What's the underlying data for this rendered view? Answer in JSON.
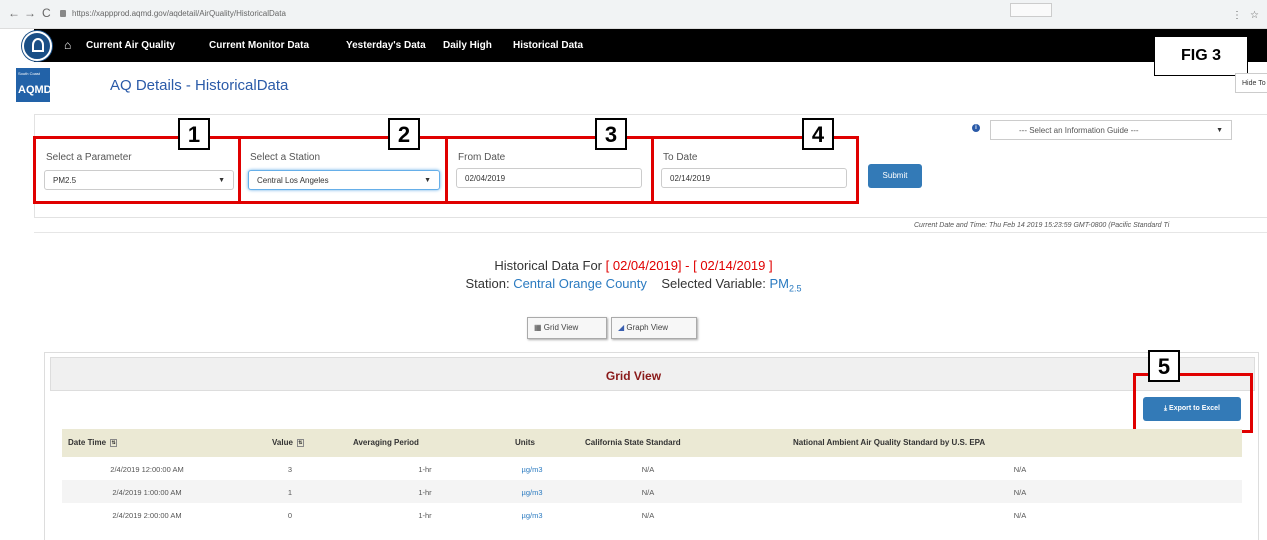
{
  "browser": {
    "back": "←",
    "forward": "→",
    "reload": "C",
    "url": "https://xappprod.aqmd.gov/aqdetail/AirQuality/HistoricalData"
  },
  "nav": {
    "items": [
      "Current Air Quality",
      "Current Monitor Data",
      "Yesterday's Data",
      "Daily High",
      "Historical Data"
    ]
  },
  "logo": {
    "small": "South Coast",
    "text": "AQMD"
  },
  "page_title": "AQ Details - HistoricalData",
  "hide_button": "Hide To",
  "fig_label": "FIG 3",
  "filters": {
    "parameter": {
      "label": "Select a Parameter",
      "value": "PM2.5",
      "callout": "1"
    },
    "station": {
      "label": "Select a Station",
      "value": "Central Los Angeles",
      "callout": "2"
    },
    "from_date": {
      "label": "From Date",
      "value": "02/04/2019",
      "callout": "3"
    },
    "to_date": {
      "label": "To Date",
      "value": "02/14/2019",
      "callout": "4"
    },
    "submit": "Submit",
    "info_guide": "--- Select an Information Guide ---"
  },
  "current_datetime": "Current Date and Time: Thu Feb 14 2019 15:23:59 GMT-0800 (Pacific Standard Ti",
  "heading": {
    "prefix": "Historical Data For",
    "range": "[ 02/04/2019] - [ 02/14/2019 ]",
    "station_label": "Station:",
    "station_value": "Central Orange County",
    "variable_label": "Selected Variable:",
    "variable_value": "PM",
    "variable_sub": "2.5"
  },
  "view_buttons": {
    "grid": "Grid View",
    "graph": "Graph View"
  },
  "grid": {
    "title": "Grid View",
    "export": "Export to Excel",
    "export_callout": "5",
    "columns": [
      "Date Time",
      "Value",
      "Averaging Period",
      "Units",
      "California State Standard",
      "National Ambient Air Quality Standard by U.S. EPA"
    ],
    "rows": [
      [
        "2/4/2019 12:00:00 AM",
        "3",
        "1-hr",
        "µg/m3",
        "N/A",
        "N/A"
      ],
      [
        "2/4/2019 1:00:00 AM",
        "1",
        "1-hr",
        "µg/m3",
        "N/A",
        "N/A"
      ],
      [
        "2/4/2019 2:00:00 AM",
        "0",
        "1-hr",
        "µg/m3",
        "N/A",
        "N/A"
      ]
    ]
  },
  "colors": {
    "nav_bg": "#000000",
    "accent": "#337ab7",
    "callout_red": "#e00000",
    "title_blue": "#2a5aa8",
    "header_row": "#ebe9d4"
  }
}
